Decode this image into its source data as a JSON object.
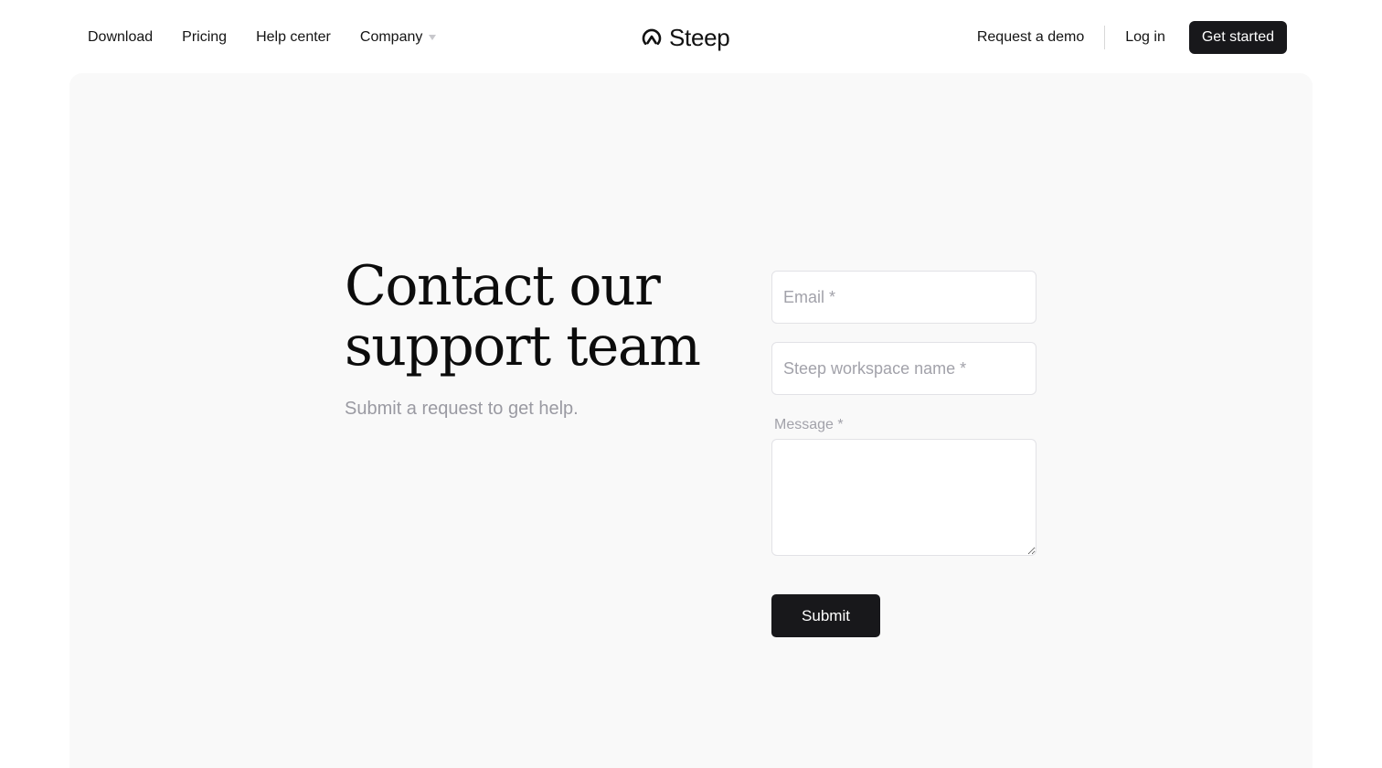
{
  "nav": {
    "links": [
      "Download",
      "Pricing",
      "Help center"
    ],
    "company_label": "Company",
    "company_caret_icon": "caret-down-icon",
    "logo_icon": "steep-mountain-logo-icon",
    "logo_text": "Steep",
    "request_demo": "Request a demo",
    "login": "Log in",
    "get_started": "Get started"
  },
  "main": {
    "title": "Contact our support team",
    "subtitle": "Submit a request to get help.",
    "form": {
      "email_placeholder": "Email *",
      "email_value": "",
      "workspace_placeholder": "Steep workspace name *",
      "workspace_value": "",
      "message_label": "Message *",
      "message_value": "",
      "submit_label": "Submit"
    }
  },
  "colors": {
    "accent": "#18181b",
    "panel_bg": "#f9f9f9",
    "muted_text": "#9a9aa2"
  }
}
